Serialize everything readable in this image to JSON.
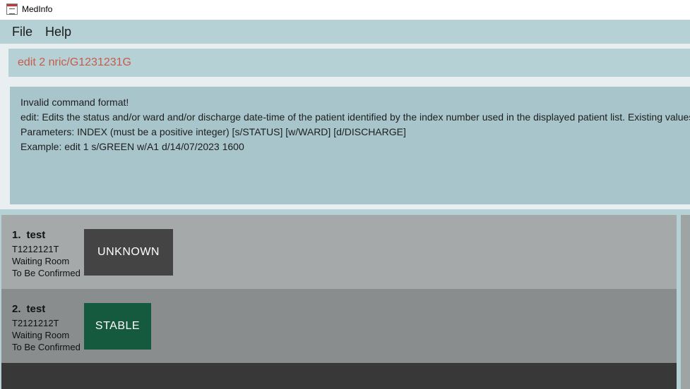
{
  "window": {
    "title": "MedInfo",
    "icon": "app-calendar-icon"
  },
  "menu": {
    "items": [
      "File",
      "Help"
    ]
  },
  "command": {
    "value": "edit 2 nric/G1231231G"
  },
  "result": {
    "lines": [
      "Invalid command format!",
      "edit: Edits the status and/or ward and/or discharge date-time of the patient identified by the index number used in the displayed patient list. Existing values",
      "Parameters: INDEX (must be a positive integer) [s/STATUS] [w/WARD] [d/DISCHARGE]",
      "Example: edit 1 s/GREEN w/A1 d/14/07/2023 1600"
    ]
  },
  "patients": [
    {
      "index": "1.",
      "name": "test",
      "nric": "T1212121T",
      "ward": "Waiting Room",
      "discharge": "To Be Confirmed",
      "status": "UNKNOWN",
      "status_color": "#444444"
    },
    {
      "index": "2.",
      "name": "test",
      "nric": "T2121212T",
      "ward": "Waiting Room",
      "discharge": "To Be Confirmed",
      "status": "STABLE",
      "status_color": "#155a3e"
    }
  ],
  "colors": {
    "accent": "#b6d1d6",
    "result_bg": "#a7c5ca",
    "command_text": "#c85a4a"
  }
}
